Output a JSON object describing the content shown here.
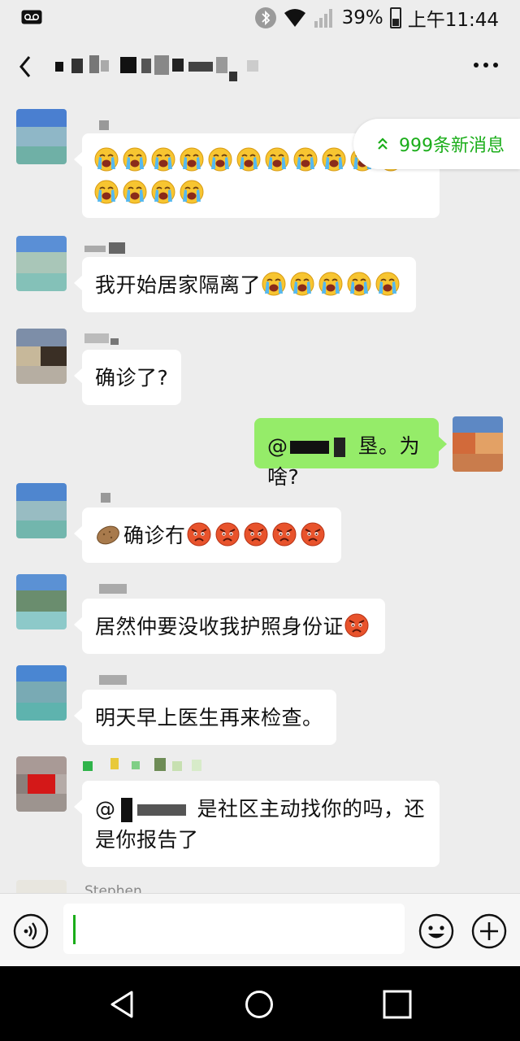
{
  "status_bar": {
    "battery": "39%",
    "time": "上午11:44",
    "battery_level": 0.39
  },
  "header": {
    "back_icon": "back-chevron-icon",
    "more_icon": "more-dots-icon"
  },
  "new_messages": {
    "label": "999条新消息",
    "icon": "double-chevron-up-icon",
    "color": "#1aad19"
  },
  "messages": [
    {
      "side": "left",
      "emoji_rows": [
        11,
        4
      ],
      "emoji": "loudly-crying-face"
    },
    {
      "side": "left",
      "text": "我开始居家隔离了",
      "emoji_count": 5,
      "emoji": "loudly-crying-face"
    },
    {
      "side": "left",
      "text": "确诊了?"
    },
    {
      "side": "right",
      "mention": "@",
      "text": "垦。为啥?"
    },
    {
      "side": "left",
      "text": "确诊冇",
      "leading_emoji": "potato",
      "emoji_count": 5,
      "emoji": "pouting-face"
    },
    {
      "side": "left",
      "text": "居然仲要没收我护照身份证",
      "emoji_count": 1,
      "emoji": "pouting-face"
    },
    {
      "side": "left",
      "text": "明天早上医生再来检查。"
    },
    {
      "side": "left",
      "mention": "@",
      "text_a": "是社区主动找你的吗，还",
      "text_b": "是你报告了"
    },
    {
      "side": "left",
      "sender": "Stephen"
    }
  ],
  "input_bar": {
    "voice_icon": "voice-icon",
    "emoji_icon": "smiley-icon",
    "plus_icon": "plus-icon",
    "value": ""
  },
  "nav_bar": {
    "back": "nav-back-icon",
    "home": "nav-home-icon",
    "recents": "nav-recents-icon"
  },
  "colors": {
    "background": "#ededed",
    "my_bubble": "#95ec69",
    "their_bubble": "#ffffff",
    "accent": "#1aad19"
  }
}
